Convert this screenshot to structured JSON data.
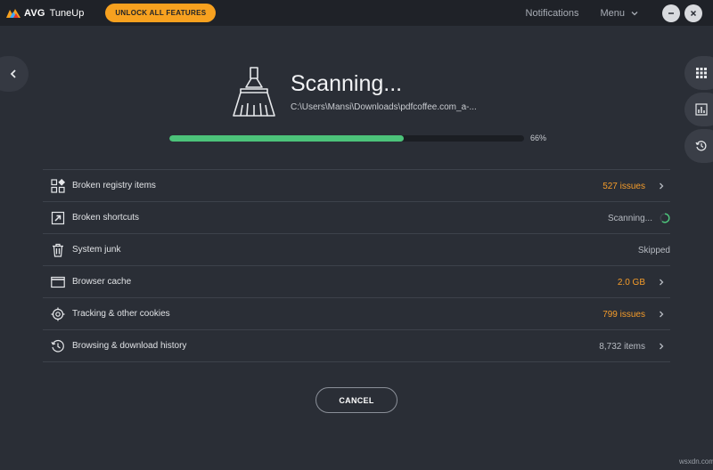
{
  "app": {
    "brand": "AVG",
    "product": "TuneUp"
  },
  "titlebar": {
    "unlock_label": "UNLOCK ALL FEATURES",
    "notifications_label": "Notifications",
    "menu_label": "Menu"
  },
  "scan": {
    "title": "Scanning...",
    "path": "C:\\Users\\Mansi\\Downloads\\pdfcoffee.com_a-...",
    "progress_percent": 66,
    "progress_label": "66%"
  },
  "items": [
    {
      "label": "Broken registry items",
      "status": "527 issues",
      "status_color": "orange",
      "icon": "registry-icon",
      "has_chevron": true
    },
    {
      "label": "Broken shortcuts",
      "status": "Scanning...",
      "status_color": "gray",
      "icon": "shortcut-icon",
      "has_spinner": true
    },
    {
      "label": "System junk",
      "status": "Skipped",
      "status_color": "gray",
      "icon": "trash-icon"
    },
    {
      "label": "Browser cache",
      "status": "2.0 GB",
      "status_color": "orange",
      "icon": "browser-window-icon",
      "has_chevron": true
    },
    {
      "label": "Tracking & other cookies",
      "status": "799 issues",
      "status_color": "orange",
      "icon": "target-icon",
      "has_chevron": true
    },
    {
      "label": "Browsing & download history",
      "status": "8,732 items",
      "status_color": "gray",
      "icon": "history-icon",
      "has_chevron": true
    }
  ],
  "cancel_label": "CANCEL",
  "watermark": "wsxdn.com",
  "colors": {
    "accent_orange": "#f7a11f",
    "progress_green": "#4cc37a",
    "background": "#2a2e36"
  }
}
